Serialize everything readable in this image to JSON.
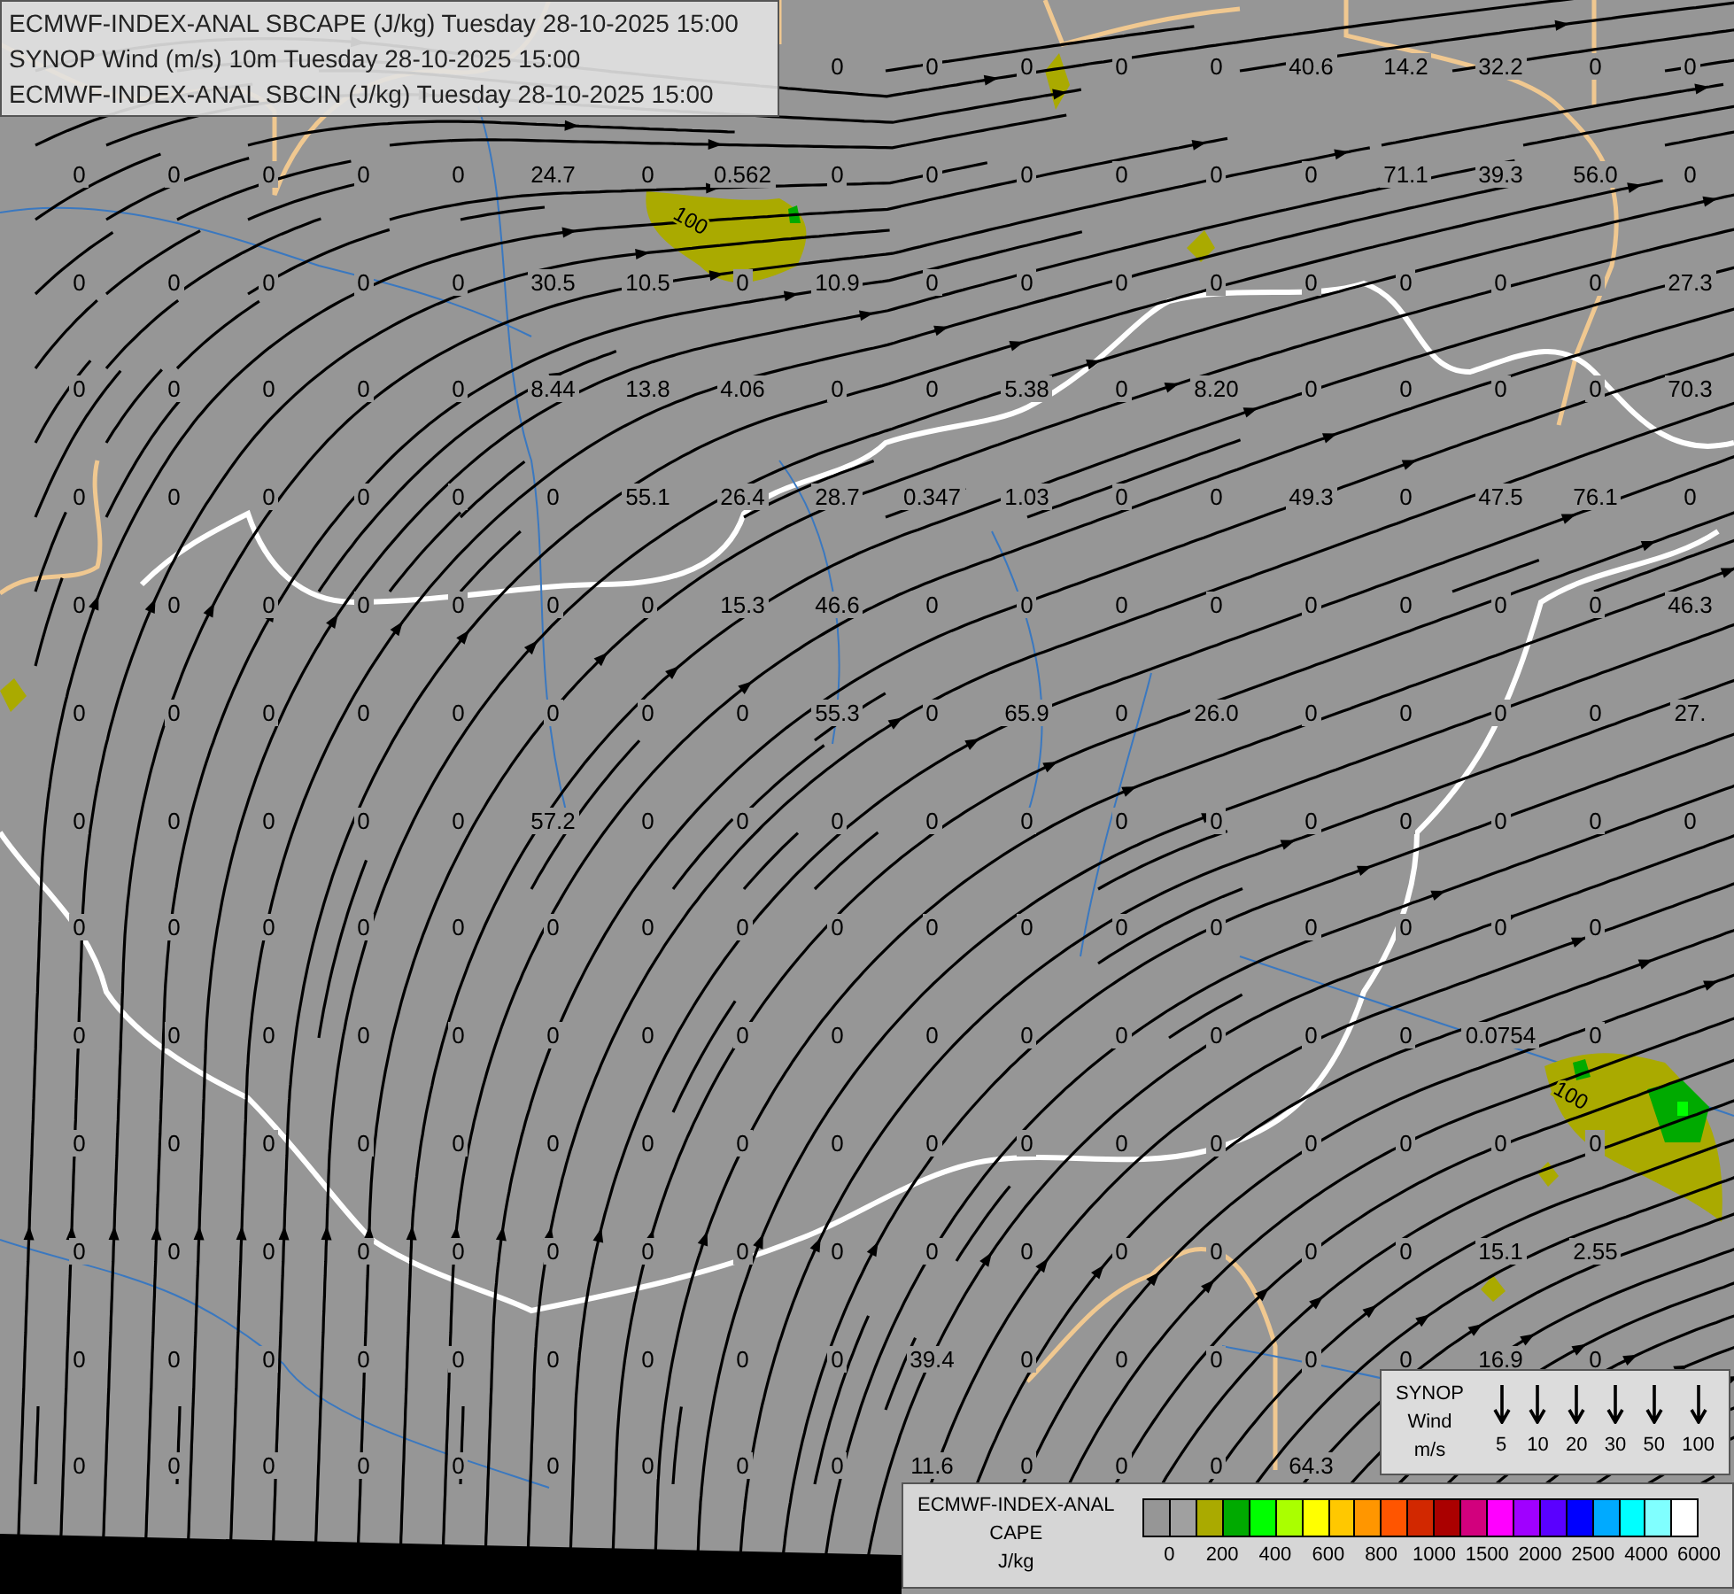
{
  "title_box": {
    "lines": [
      "ECMWF-INDEX-ANAL SBCAPE (J/kg) Tuesday 28-10-2025 15:00",
      "SYNOP Wind (m/s) 10m Tuesday 28-10-2025 15:00",
      "ECMWF-INDEX-ANAL SBCIN (J/kg) Tuesday 28-10-2025 15:00"
    ]
  },
  "map": {
    "top_row": [
      "0",
      "0",
      "0",
      "0",
      "0",
      "40.6",
      "14.2",
      "32.2",
      "0",
      "0"
    ],
    "value_grid": [
      [
        "0",
        "0",
        "0",
        "0",
        "0",
        "24.7",
        "0",
        "0.562",
        "0",
        "0",
        "0",
        "0",
        "0",
        "0",
        "71.1",
        "39.3",
        "56.0",
        "0"
      ],
      [
        "0",
        "0",
        "0",
        "0",
        "0",
        "30.5",
        "10.5",
        "0",
        "10.9",
        "0",
        "0",
        "0",
        "0",
        "0",
        "0",
        "0",
        "0",
        "27.3"
      ],
      [
        "0",
        "0",
        "0",
        "0",
        "0",
        "8.44",
        "13.8",
        "4.06",
        "0",
        "0",
        "5.38",
        "0",
        "8.20",
        "0",
        "0",
        "0",
        "0",
        "70.3"
      ],
      [
        "0",
        "0",
        "0",
        "0",
        "0",
        "0",
        "55.1",
        "26.4",
        "28.7",
        "0.347",
        "1.03",
        "0",
        "0",
        "49.3",
        "0",
        "47.5",
        "76.1",
        "0"
      ],
      [
        "0",
        "0",
        "0",
        "0",
        "0",
        "0",
        "0",
        "15.3",
        "46.6",
        "0",
        "0",
        "0",
        "0",
        "0",
        "0",
        "0",
        "0",
        "46.3"
      ],
      [
        "0",
        "0",
        "0",
        "0",
        "0",
        "0",
        "0",
        "0",
        "55.3",
        "0",
        "65.9",
        "0",
        "26.0",
        "0",
        "0",
        "0",
        "0",
        "27."
      ],
      [
        "0",
        "0",
        "0",
        "0",
        "0",
        "57.2",
        "0",
        "0",
        "0",
        "0",
        "0",
        "0",
        "0",
        "0",
        "0",
        "0",
        "0",
        "0"
      ],
      [
        "0",
        "0",
        "0",
        "0",
        "0",
        "0",
        "0",
        "0",
        "0",
        "0",
        "0",
        "0",
        "0",
        "0",
        "0",
        "0",
        "0"
      ],
      [
        "0",
        "0",
        "0",
        "0",
        "0",
        "0",
        "0",
        "0",
        "0",
        "0",
        "0",
        "0",
        "0",
        "0",
        "0",
        "0.0754",
        "0"
      ],
      [
        "0",
        "0",
        "0",
        "0",
        "0",
        "0",
        "0",
        "0",
        "0",
        "0",
        "0",
        "0",
        "0",
        "0",
        "0",
        "0",
        "0"
      ],
      [
        "0",
        "0",
        "0",
        "0",
        "0",
        "0",
        "0",
        "0",
        "0",
        "0",
        "0",
        "0",
        "0",
        "0",
        "0",
        "15.1",
        "2.55"
      ],
      [
        "0",
        "0",
        "0",
        "0",
        "0",
        "0",
        "0",
        "0",
        "0",
        "39.4",
        "0",
        "0",
        "0",
        "0",
        "0",
        "16.9",
        "0"
      ],
      [
        "0",
        "0",
        "0",
        "0",
        "0",
        "0",
        "0",
        "0",
        "0",
        "11.6",
        "0",
        "0",
        "0",
        "64.3"
      ]
    ],
    "contour_labels": [
      "100",
      "100"
    ]
  },
  "wind_legend": {
    "title_lines": [
      "SYNOP",
      "Wind",
      "m/s"
    ],
    "speeds": [
      "5",
      "10",
      "20",
      "30",
      "50",
      "100"
    ]
  },
  "cape_legend": {
    "title_lines": [
      "ECMWF-INDEX-ANAL",
      "CAPE",
      "J/kg"
    ],
    "swatches": [
      {
        "color": "#969696"
      },
      {
        "color": "#a0a0a0"
      },
      {
        "color": "#aaaa00"
      },
      {
        "color": "#00aa00"
      },
      {
        "color": "#00ff00"
      },
      {
        "color": "#aaff00"
      },
      {
        "color": "#ffff00"
      },
      {
        "color": "#ffc800"
      },
      {
        "color": "#ff9600"
      },
      {
        "color": "#ff5500"
      },
      {
        "color": "#d22800"
      },
      {
        "color": "#aa0000"
      },
      {
        "color": "#d2007d"
      },
      {
        "color": "#ff00ff"
      },
      {
        "color": "#a000ff"
      },
      {
        "color": "#5a00ff"
      },
      {
        "color": "#0000ff"
      },
      {
        "color": "#00aaff"
      },
      {
        "color": "#00ffff"
      },
      {
        "color": "#80ffff"
      },
      {
        "color": "#ffffff"
      }
    ],
    "ticks": [
      "0",
      "200",
      "400",
      "600",
      "800",
      "1000",
      "1500",
      "2000",
      "2500",
      "4000",
      "6000"
    ]
  }
}
